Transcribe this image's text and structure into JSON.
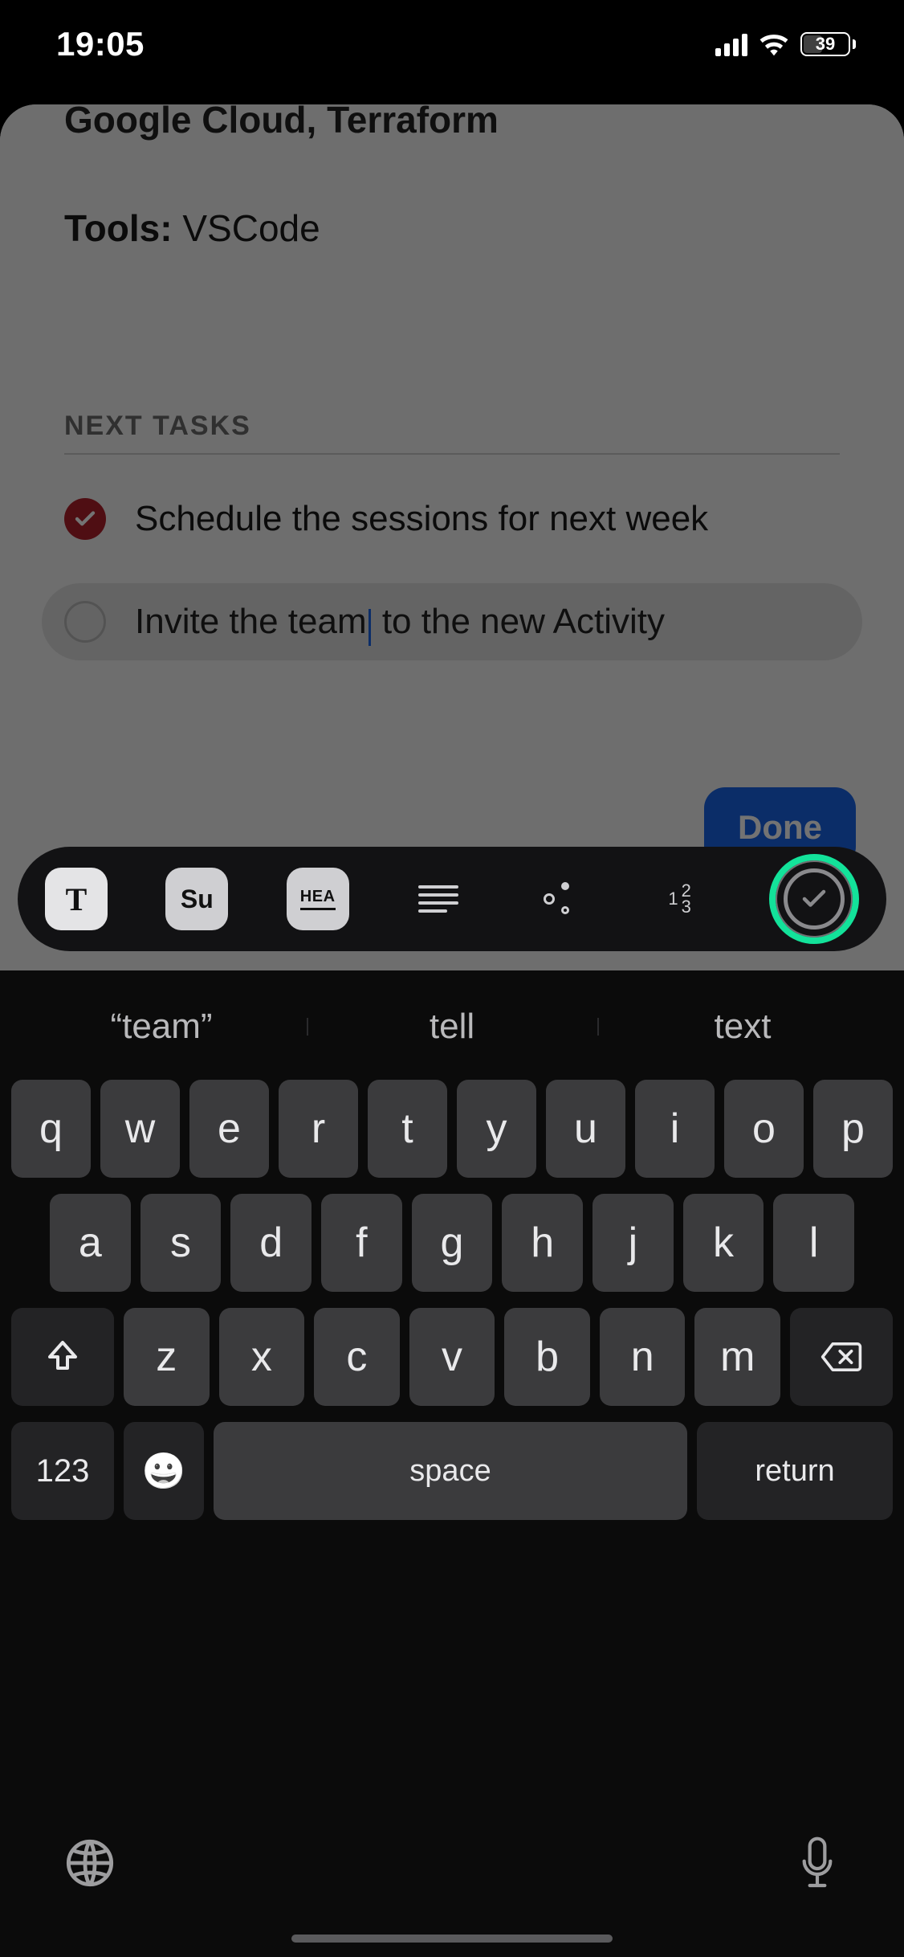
{
  "status_bar": {
    "time": "19:05",
    "battery_percent": "39"
  },
  "content": {
    "partial_text": "Google Cloud, Terraform",
    "tools_label": "Tools:",
    "tools_value": " VSCode",
    "section_header": "NEXT TASKS",
    "tasks": [
      {
        "text": "Schedule the sessions for next week",
        "done": true
      },
      {
        "text_before": "Invite the team",
        "text_after": " to the new Activity",
        "done": false,
        "editing": true
      }
    ],
    "done_button": "Done"
  },
  "style_toolbar": {
    "items": [
      "text-style",
      "subheading",
      "heading",
      "paragraph-align",
      "bullet-list",
      "numbered-list",
      "checklist"
    ],
    "t_label": "T",
    "su_label": "Su",
    "hea_label": "HEA",
    "num1": "1",
    "num2": "2",
    "num3": "3",
    "highlighted": "checklist"
  },
  "keyboard": {
    "suggestions": [
      "“team”",
      "tell",
      "text"
    ],
    "row1": [
      "q",
      "w",
      "e",
      "r",
      "t",
      "y",
      "u",
      "i",
      "o",
      "p"
    ],
    "row2": [
      "a",
      "s",
      "d",
      "f",
      "g",
      "h",
      "j",
      "k",
      "l"
    ],
    "row3": [
      "z",
      "x",
      "c",
      "v",
      "b",
      "n",
      "m"
    ],
    "numbers_key": "123",
    "space_key": "space",
    "return_key": "return",
    "emoji": "😀"
  }
}
